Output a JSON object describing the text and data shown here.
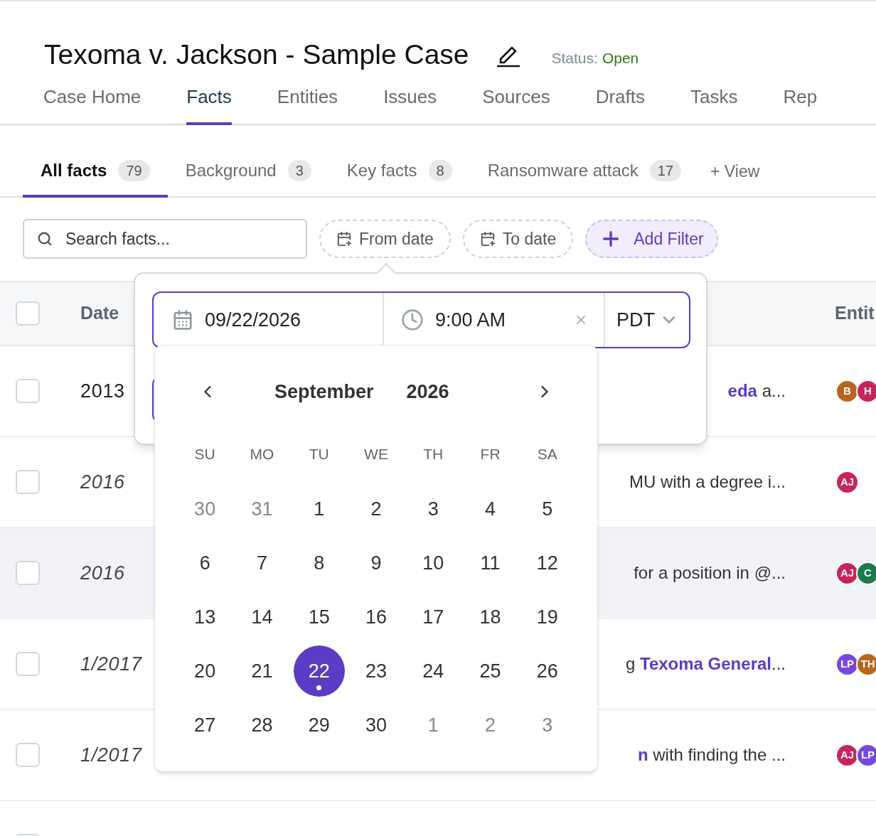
{
  "case": {
    "title": "Texoma v. Jackson - Sample Case",
    "status_label": "Status:",
    "status": "Open"
  },
  "nav_tabs": [
    {
      "label": "Case Home",
      "selected": false
    },
    {
      "label": "Facts",
      "selected": true
    },
    {
      "label": "Entities",
      "selected": false
    },
    {
      "label": "Issues",
      "selected": false
    },
    {
      "label": "Sources",
      "selected": false
    },
    {
      "label": "Drafts",
      "selected": false
    },
    {
      "label": "Tasks",
      "selected": false
    },
    {
      "label": "Rep",
      "selected": false
    }
  ],
  "view_tabs": [
    {
      "label": "All facts",
      "count": "79",
      "selected": true
    },
    {
      "label": "Background",
      "count": "3",
      "selected": false
    },
    {
      "label": "Key facts",
      "count": "8",
      "selected": false
    },
    {
      "label": "Ransomware attack",
      "count": "17",
      "selected": false
    }
  ],
  "add_view": "+ View",
  "filters": {
    "search_placeholder": "Search facts...",
    "from_date": "From date",
    "to_date": "To date",
    "add_filter": "Add Filter"
  },
  "table": {
    "columns": [
      "Date",
      "Entit"
    ],
    "select_all": {
      "checked": false
    },
    "rows": [
      {
        "checked": false,
        "hovered": false,
        "date": "2013",
        "estimated": false,
        "description": [
          {
            "text": "eda",
            "link": true
          },
          {
            "text": " a...",
            "link": false
          }
        ],
        "entities": [
          {
            "initials": "B",
            "color": "#b8651f"
          },
          {
            "initials": "H",
            "color": "#c8245c"
          }
        ]
      },
      {
        "checked": false,
        "hovered": false,
        "date": "2016",
        "estimated": true,
        "description": [
          {
            "text": "MU with a degree i...",
            "link": false
          }
        ],
        "entities": [
          {
            "initials": "AJ",
            "color": "#c8245c"
          }
        ]
      },
      {
        "checked": false,
        "hovered": true,
        "date": "2016",
        "estimated": true,
        "description": [
          {
            "text": "for a position in @...",
            "link": false
          }
        ],
        "entities": [
          {
            "initials": "AJ",
            "color": "#c8245c"
          },
          {
            "initials": "C",
            "color": "#1d7a4a"
          }
        ]
      },
      {
        "checked": false,
        "hovered": false,
        "date": "1/2017",
        "estimated": true,
        "description": [
          {
            "text": "g ",
            "link": false
          },
          {
            "text": "Texoma General",
            "link": true
          },
          {
            "text": "...",
            "link": false
          }
        ],
        "entities": [
          {
            "initials": "LP",
            "color": "#7447e0"
          },
          {
            "initials": "TH",
            "color": "#b8651f"
          }
        ]
      },
      {
        "checked": false,
        "hovered": false,
        "date": "1/2017",
        "estimated": true,
        "description": [
          {
            "text": "n",
            "link": true
          },
          {
            "text": " with finding the ...",
            "link": false
          }
        ],
        "entities": [
          {
            "initials": "AJ",
            "color": "#c8245c"
          },
          {
            "initials": "LP",
            "color": "#7447e0"
          }
        ]
      },
      {
        "checked": false,
        "description": [],
        "entities": []
      }
    ]
  },
  "picker": {
    "date": "09/22/2026",
    "time": "9:00 AM",
    "timezone": "PDT",
    "month": "September",
    "year": "2026",
    "weekdays": [
      "SU",
      "MO",
      "TU",
      "WE",
      "TH",
      "FR",
      "SA"
    ],
    "weeks": [
      [
        {
          "day": "30",
          "outside": true,
          "selected": false,
          "today": false
        },
        {
          "day": "31",
          "outside": true,
          "selected": false,
          "today": false
        },
        {
          "day": "1",
          "outside": false,
          "selected": false,
          "today": false
        },
        {
          "day": "2",
          "outside": false,
          "selected": false,
          "today": false
        },
        {
          "day": "3",
          "outside": false,
          "selected": false,
          "today": false
        },
        {
          "day": "4",
          "outside": false,
          "selected": false,
          "today": false
        },
        {
          "day": "5",
          "outside": false,
          "selected": false,
          "today": false
        }
      ],
      [
        {
          "day": "6",
          "outside": false,
          "selected": false,
          "today": false
        },
        {
          "day": "7",
          "outside": false,
          "selected": false,
          "today": false
        },
        {
          "day": "8",
          "outside": false,
          "selected": false,
          "today": false
        },
        {
          "day": "9",
          "outside": false,
          "selected": false,
          "today": false
        },
        {
          "day": "10",
          "outside": false,
          "selected": false,
          "today": false
        },
        {
          "day": "11",
          "outside": false,
          "selected": false,
          "today": false
        },
        {
          "day": "12",
          "outside": false,
          "selected": false,
          "today": false
        }
      ],
      [
        {
          "day": "13",
          "outside": false,
          "selected": false,
          "today": false
        },
        {
          "day": "14",
          "outside": false,
          "selected": false,
          "today": false
        },
        {
          "day": "15",
          "outside": false,
          "selected": false,
          "today": false
        },
        {
          "day": "16",
          "outside": false,
          "selected": false,
          "today": false
        },
        {
          "day": "17",
          "outside": false,
          "selected": false,
          "today": false
        },
        {
          "day": "18",
          "outside": false,
          "selected": false,
          "today": false
        },
        {
          "day": "19",
          "outside": false,
          "selected": false,
          "today": false
        }
      ],
      [
        {
          "day": "20",
          "outside": false,
          "selected": false,
          "today": false
        },
        {
          "day": "21",
          "outside": false,
          "selected": false,
          "today": false
        },
        {
          "day": "22",
          "outside": false,
          "selected": true,
          "today": true
        },
        {
          "day": "23",
          "outside": false,
          "selected": false,
          "today": false
        },
        {
          "day": "24",
          "outside": false,
          "selected": false,
          "today": false
        },
        {
          "day": "25",
          "outside": false,
          "selected": false,
          "today": false
        },
        {
          "day": "26",
          "outside": false,
          "selected": false,
          "today": false
        }
      ],
      [
        {
          "day": "27",
          "outside": false,
          "selected": false,
          "today": false
        },
        {
          "day": "28",
          "outside": false,
          "selected": false,
          "today": false
        },
        {
          "day": "29",
          "outside": false,
          "selected": false,
          "today": false
        },
        {
          "day": "30",
          "outside": false,
          "selected": false,
          "today": false
        },
        {
          "day": "1",
          "outside": true,
          "selected": false,
          "today": false
        },
        {
          "day": "2",
          "outside": true,
          "selected": false,
          "today": false
        },
        {
          "day": "3",
          "outside": true,
          "selected": false,
          "today": false
        }
      ]
    ]
  }
}
